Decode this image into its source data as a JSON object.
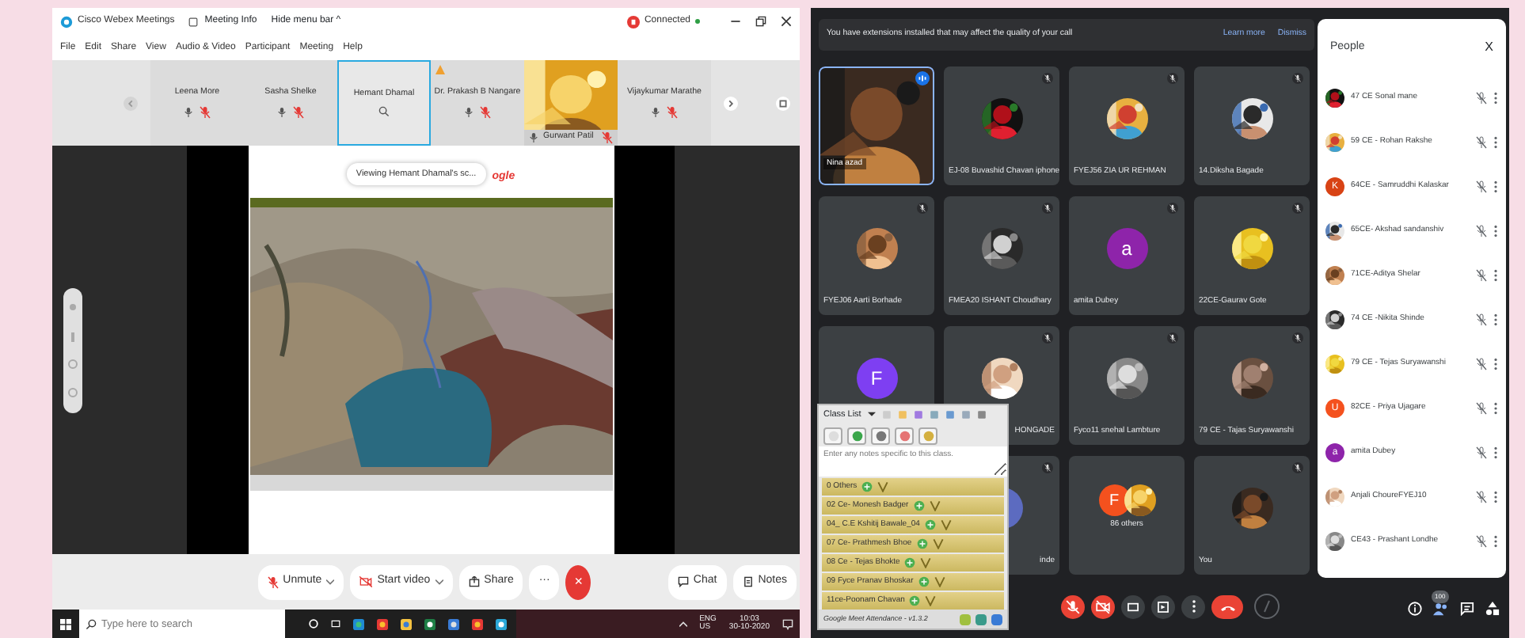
{
  "webex": {
    "title_bar": {
      "app_name": "Cisco Webex Meetings",
      "meeting_info": "Meeting Info",
      "hide_menu": "Hide menu bar ^",
      "status": "Connected"
    },
    "menu": [
      "File",
      "Edit",
      "Share",
      "View",
      "Audio & Video",
      "Participant",
      "Meeting",
      "Help"
    ],
    "participants": [
      {
        "name": "Leena More",
        "kind": "tile",
        "selected": false,
        "alert": false
      },
      {
        "name": "Sasha Shelke",
        "kind": "tile",
        "selected": false,
        "alert": false
      },
      {
        "name": "Hemant Dhamal",
        "kind": "tile",
        "selected": true,
        "alert": false
      },
      {
        "name": "Dr. Prakash B Nangare",
        "kind": "tile",
        "selected": false,
        "alert": true
      },
      {
        "name": "Gurwant Patil",
        "kind": "video",
        "selected": false,
        "alert": false
      },
      {
        "name": "Vijaykumar Marathe",
        "kind": "tile",
        "selected": false,
        "alert": false
      }
    ],
    "share": {
      "banner": "Viewing Hemant Dhamal's sc...",
      "fragment": "ogle"
    },
    "controls": [
      {
        "label": "Unmute",
        "kind": "mic",
        "dropdown": true
      },
      {
        "label": "Start video",
        "kind": "video",
        "dropdown": true
      },
      {
        "label": "Share",
        "kind": "share",
        "dropdown": false
      },
      {
        "label": "···",
        "kind": "more",
        "dropdown": false
      },
      {
        "label": "×",
        "kind": "end",
        "dropdown": false
      }
    ],
    "side_controls": [
      {
        "label": "Chat",
        "kind": "chat"
      },
      {
        "label": "Notes",
        "kind": "notes"
      }
    ]
  },
  "taskbar": {
    "search_placeholder": "Type here to search",
    "language": "ENG",
    "region": "US",
    "time": "10:03",
    "date": "30-10-2020"
  },
  "meet": {
    "banner": {
      "message": "You have extensions installed that may affect the quality of your call",
      "links": [
        "Learn more",
        "Dismiss"
      ]
    },
    "tile_rows": [
      [
        {
          "name": "Nina azad",
          "kind": "video",
          "speaking": true,
          "muted": false
        },
        {
          "name": "EJ-08 Buvashid Chavan iphone",
          "kind": "avatar",
          "avatar": {
            "kind": "picture"
          },
          "speaking": false,
          "muted": true
        },
        {
          "name": "FYEJ56 ZIA UR REHMAN",
          "kind": "avatar",
          "avatar": {
            "kind": "picture"
          },
          "speaking": false,
          "muted": true
        },
        {
          "name": "14.Diksha Bagade",
          "kind": "avatar",
          "avatar": {
            "kind": "picture"
          },
          "speaking": false,
          "muted": true
        }
      ],
      [
        {
          "name": "FYEJ06 Aarti Borhade",
          "kind": "avatar",
          "avatar": {
            "kind": "picture"
          },
          "speaking": false,
          "muted": true
        },
        {
          "name": "FMEA20 ISHANT Choudhary",
          "kind": "avatar",
          "avatar": {
            "kind": "picture"
          },
          "speaking": false,
          "muted": true
        },
        {
          "name": "amita Dubey",
          "kind": "avatar",
          "avatar": {
            "kind": "letter",
            "letter": "a",
            "color": "#8e24aa"
          },
          "speaking": false,
          "muted": true
        },
        {
          "name": "22CE-Gaurav Gote",
          "kind": "avatar",
          "avatar": {
            "kind": "picture"
          },
          "speaking": false,
          "muted": true
        }
      ],
      [
        {
          "kind": "avatar",
          "avatar": {
            "kind": "letter",
            "letter": "F",
            "color": "#7e3ff2"
          },
          "speaking": false,
          "muted": false
        },
        {
          "name": "HONGADE",
          "kind": "covered",
          "avatar": {
            "kind": "picture"
          },
          "speaking": false,
          "muted": true
        },
        {
          "name": "Fyco11 snehal Lambture",
          "kind": "avatar",
          "avatar": {
            "kind": "picture"
          },
          "speaking": false,
          "muted": true
        },
        {
          "name": "79 CE - Tajas Suryawanshi",
          "kind": "avatar",
          "avatar": {
            "kind": "picture"
          },
          "speaking": false,
          "muted": true
        }
      ],
      [
        {
          "name": "inde",
          "kind": "covered",
          "avatar": {
            "kind": "letter",
            "color": "#5c6bc0"
          },
          "speaking": false,
          "muted": true
        },
        {
          "name": "86 others",
          "kind": "others",
          "avatars": [
            {
              "kind": "letter",
              "letter": "F",
              "color": "#f4511e"
            },
            {
              "kind": "picture"
            }
          ],
          "speaking": false,
          "muted": false
        },
        {
          "name": "You",
          "kind": "avatar",
          "avatar": {
            "kind": "picture"
          },
          "speaking": false,
          "muted": true
        }
      ]
    ],
    "class_list": {
      "title": "Class List",
      "notes_placeholder": "Enter any notes specific to this class.",
      "students": [
        "0 Others",
        "02 Ce- Monesh Badger",
        "04_ C.E Kshitij Bawale_04",
        "07 Ce- Prathmesh Bhoe",
        "08 Ce - Tejas Bhokte",
        "09 Fyce Pranav Bhoskar",
        "11ce-Poonam Chavan"
      ],
      "footer": "Google Meet Attendance - v1.3.2"
    },
    "call_controls": [
      {
        "kind": "mic",
        "off": true
      },
      {
        "kind": "camera",
        "off": true
      },
      {
        "kind": "captions",
        "off": false
      },
      {
        "kind": "present",
        "off": false
      },
      {
        "kind": "more",
        "off": false
      },
      {
        "kind": "leave"
      },
      {
        "kind": "ring"
      }
    ],
    "people": {
      "title": "People",
      "close": "X",
      "members": [
        {
          "name": "47 CE Sonal mane",
          "avatar": {
            "kind": "picture"
          }
        },
        {
          "name": "59 CE - Rohan Rakshe",
          "avatar": {
            "kind": "picture"
          }
        },
        {
          "name": "64CE - Samruddhi Kalaskar",
          "avatar": {
            "kind": "letter",
            "letter": "K",
            "color": "#d84315"
          }
        },
        {
          "name": "65CE- Akshad sandanshiv",
          "avatar": {
            "kind": "picture"
          }
        },
        {
          "name": "71CE-Aditya Shelar",
          "avatar": {
            "kind": "picture"
          }
        },
        {
          "name": "74 CE -Nikita Shinde",
          "avatar": {
            "kind": "picture"
          }
        },
        {
          "name": "79 CE - Tejas Suryawanshi",
          "avatar": {
            "kind": "picture"
          }
        },
        {
          "name": "82CE - Priya Ujagare",
          "avatar": {
            "kind": "letter",
            "letter": "U",
            "color": "#f4511e"
          }
        },
        {
          "name": "amita Dubey",
          "avatar": {
            "kind": "letter",
            "letter": "a",
            "color": "#8e24aa"
          }
        },
        {
          "name": "Anjali ChoureFYEJ10",
          "avatar": {
            "kind": "picture"
          }
        },
        {
          "name": "CE43 - Prashant Londhe",
          "avatar": {
            "kind": "picture"
          }
        }
      ]
    },
    "participant_count": "100"
  }
}
